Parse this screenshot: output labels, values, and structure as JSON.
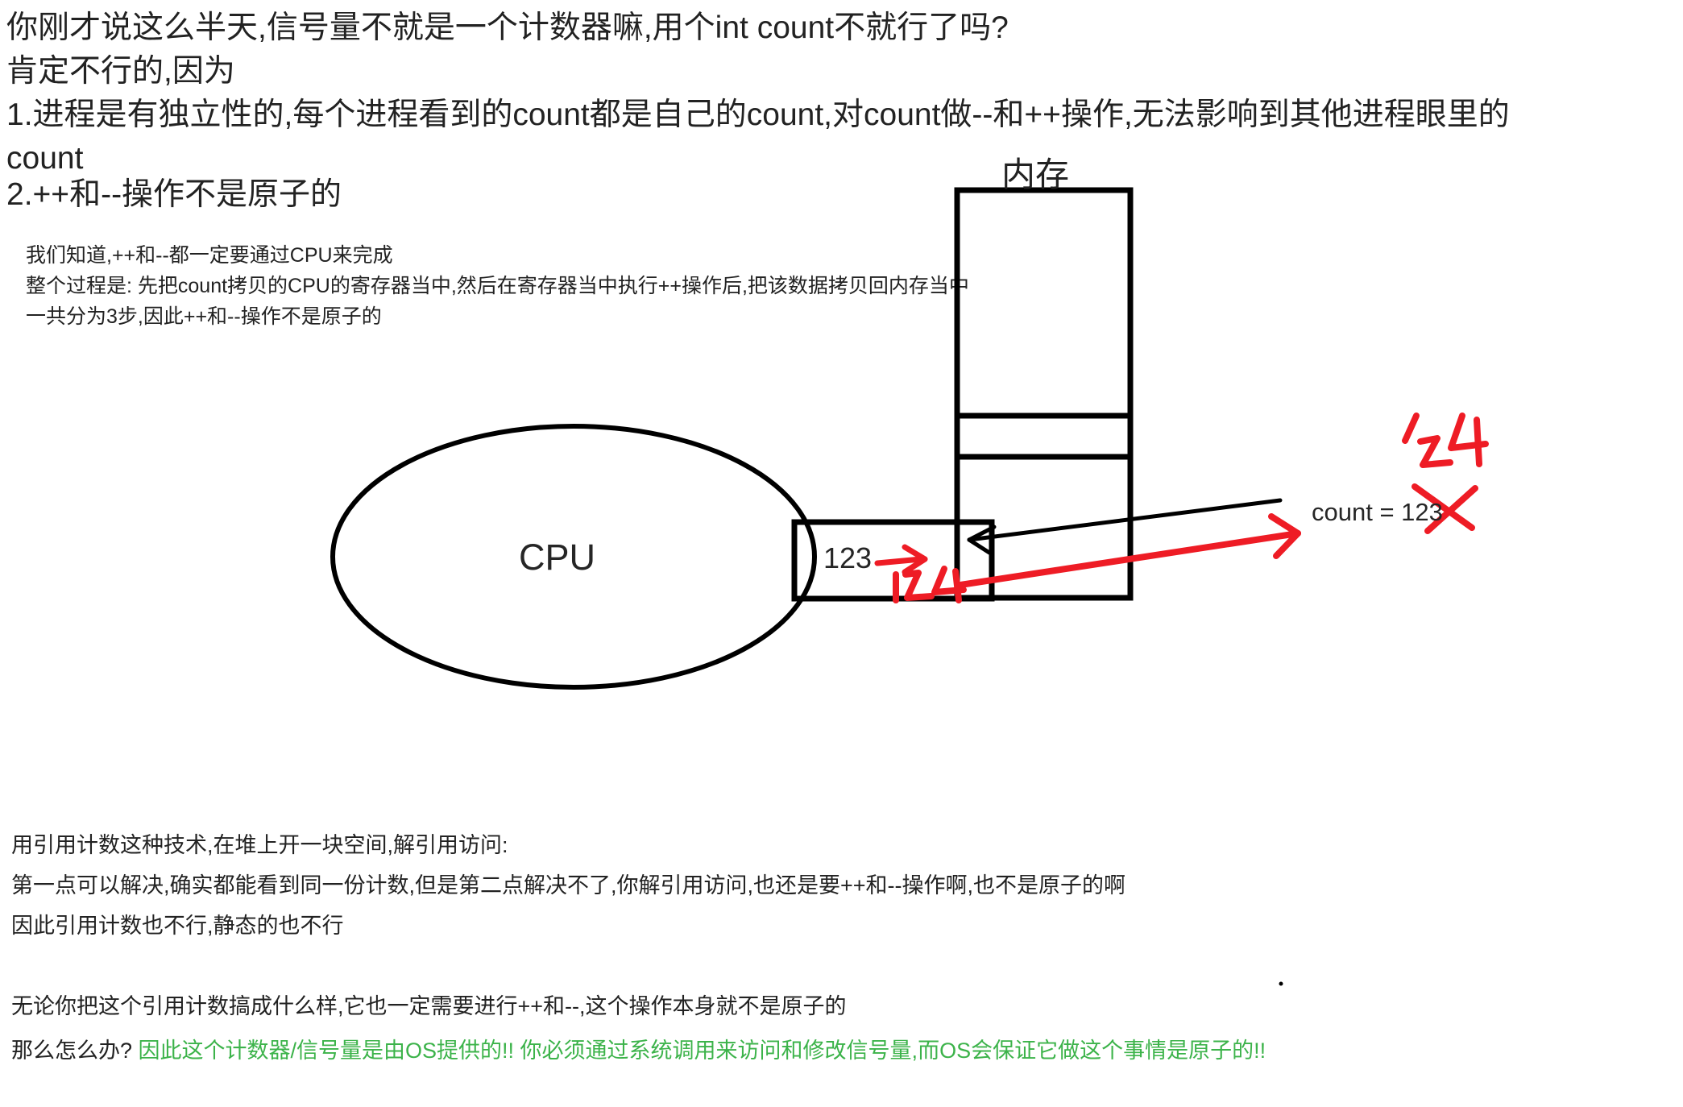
{
  "document": {
    "background_color": "#ffffff",
    "text_color": "#222222",
    "accent_red": "#ee1c25",
    "accent_green": "#3cb34a"
  },
  "intro": {
    "lines": [
      "你刚才说这么半天,信号量不就是一个计数器嘛,用个int count不就行了吗?",
      "肯定不行的,因为",
      "1.进程是有独立性的,每个进程看到的count都是自己的count,对count做--和++操作,无法影响到其他进程眼里的",
      "count",
      "2.++和--操作不是原子的"
    ]
  },
  "notes": {
    "lines": [
      "我们知道,++和--都一定要通过CPU来完成",
      "整个过程是: 先把count拷贝的CPU的寄存器当中,然后在寄存器当中执行++操作后,把该数据拷贝回内存当中",
      "一共分为3步,因此++和--操作不是原子的"
    ]
  },
  "diagram": {
    "cpu_label": "CPU",
    "register": {
      "old_value": "123",
      "arrow_glyph": "→",
      "new_value": "124"
    },
    "memory": {
      "title": "内存",
      "cell_text": "count = 123",
      "new_value": "124",
      "struck_out": true
    }
  },
  "conclusion": {
    "block1": [
      "用引用计数这种技术,在堆上开一块空间,解引用访问:",
      "第一点可以解决,确实都能看到同一份计数,但是第二点解决不了,你解引用访问,也还是要++和--操作啊,也不是原子的啊",
      "因此引用计数也不行,静态的也不行"
    ],
    "block2_line": "无论你把这个引用计数搞成什么样,它也一定需要进行++和--,这个操作本身就不是原子的",
    "final": {
      "question": "那么怎么办?",
      "answer": "因此这个计数器/信号量是由OS提供的!!  你必须通过系统调用来访问和修改信号量,而OS会保证它做这个事情是原子的!!"
    }
  }
}
